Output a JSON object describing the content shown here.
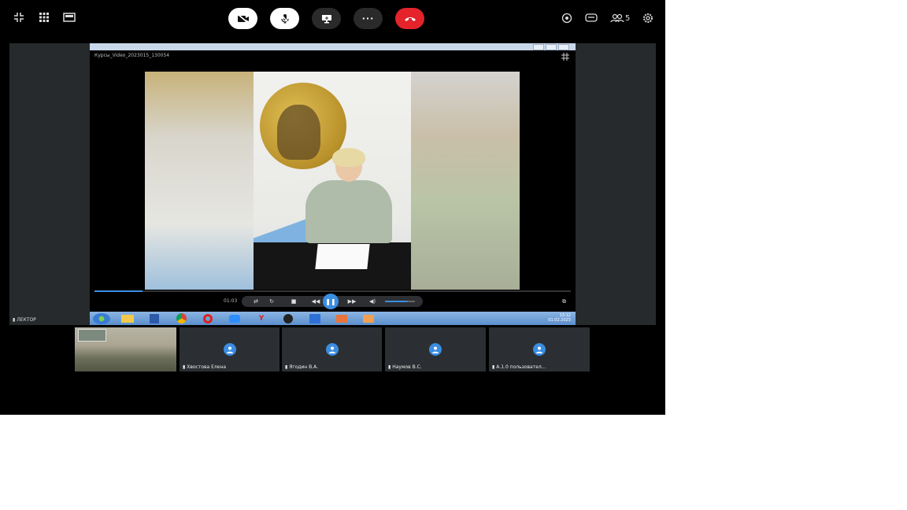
{
  "colors": {
    "background": "#000000",
    "end_call": "#e5232b",
    "accent": "#3b8de0",
    "taskbar": "#5b8fcd"
  },
  "toolbar": {
    "left_icons": [
      "collapse-icon",
      "grid-view-icon",
      "screen-layout-icon"
    ],
    "controls": [
      {
        "name": "camera-off-button",
        "icon": "camera-off-icon"
      },
      {
        "name": "mic-off-button",
        "icon": "mic-off-icon"
      },
      {
        "name": "screen-share-button",
        "icon": "screen-share-icon"
      },
      {
        "name": "more-button",
        "icon": "more-icon",
        "label": "···"
      },
      {
        "name": "end-call-button",
        "icon": "hang-up-icon"
      }
    ],
    "right_icons": [
      "record-icon",
      "chat-icon",
      "participants-icon",
      "settings-icon"
    ],
    "participants_count": "5"
  },
  "shared_screen": {
    "video_title": "Курсы_Video_2023015_130054",
    "player": {
      "elapsed": "01:03",
      "progress_percent": 10,
      "volume_percent": 75
    },
    "taskbar_clock": {
      "time": "13:12",
      "date": "01.02.2023"
    }
  },
  "stage_label": "ЛЕКТОР",
  "participants": [
    {
      "label": "",
      "has_camera": true
    },
    {
      "label": "Хвостова Елена",
      "has_camera": false
    },
    {
      "label": "Ягодин В.А.",
      "has_camera": false
    },
    {
      "label": "Наумов В.С.",
      "has_camera": false
    },
    {
      "label": "А.1.0 пользовател...",
      "has_camera": false
    }
  ]
}
